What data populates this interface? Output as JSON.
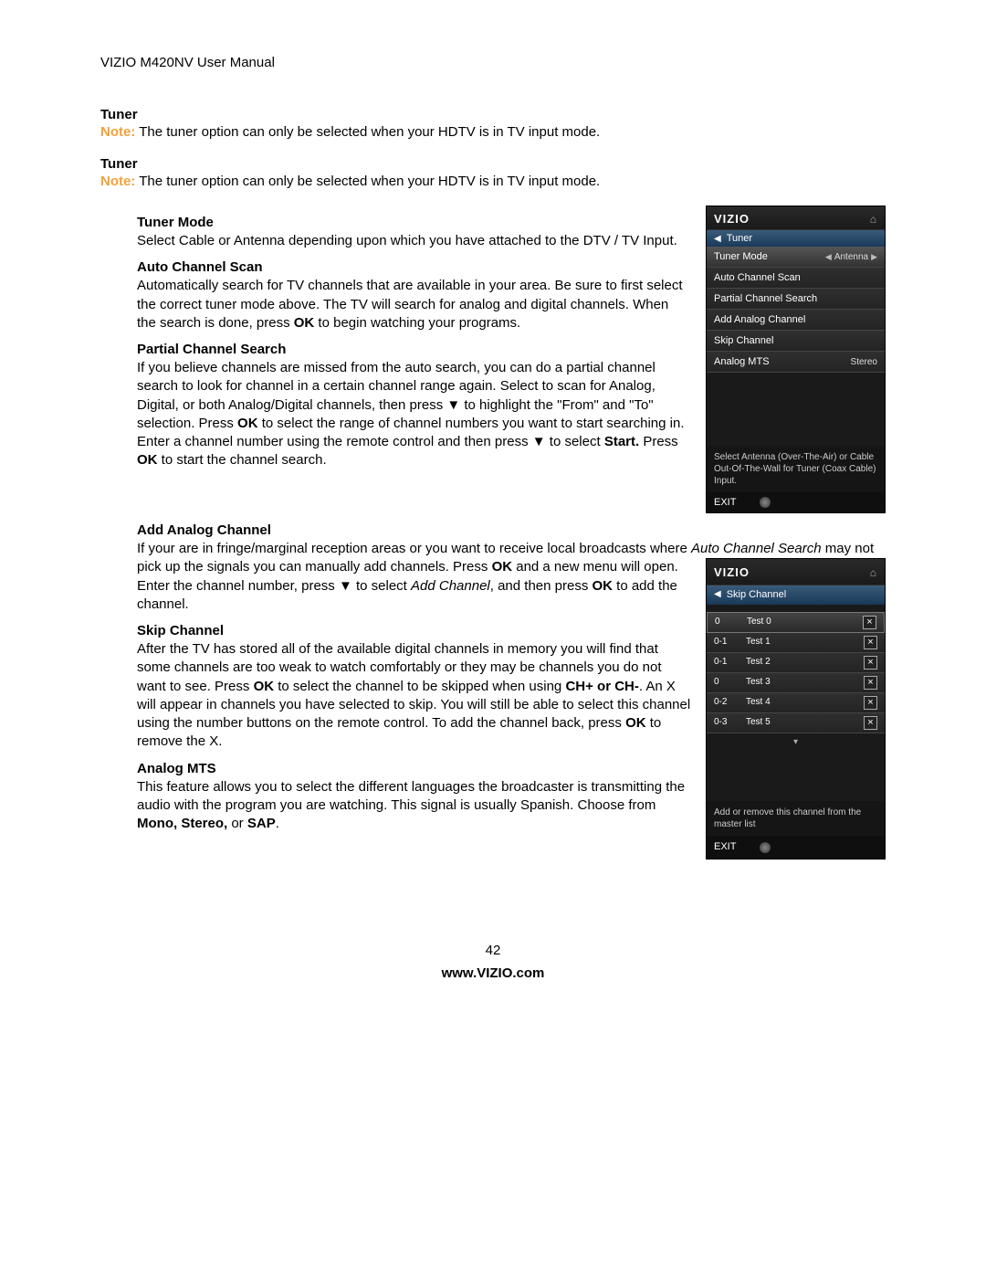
{
  "header": "VIZIO M420NV User Manual",
  "tuner1": {
    "title": "Tuner",
    "note_label": "Note:",
    "note_text": " The tuner option can only be selected when your HDTV is in TV input mode."
  },
  "tuner2": {
    "title": "Tuner",
    "note_label": "Note:",
    "note_text": " The tuner option can only be selected when your HDTV is in TV input mode."
  },
  "sections": {
    "tuner_mode": {
      "title": "Tuner Mode",
      "body": "Select Cable or Antenna depending upon which you have attached to the DTV / TV Input."
    },
    "auto_scan": {
      "title": "Auto Channel Scan",
      "body_a": "Automatically search for TV channels that are available in your area. Be sure to first select the correct tuner mode above. The TV will search for analog and digital channels. When the search is done, press ",
      "ok": "OK",
      "body_b": " to begin watching your programs."
    },
    "partial": {
      "title": "Partial Channel Search",
      "p1": "If you believe channels are missed from the auto search, you can do a partial channel search to look for channel in a certain channel range again. Select to scan for Analog, Digital, or both Analog/Digital channels, then press ▼ to highlight the \"From\" and \"To\" selection. Press ",
      "ok1": "OK",
      "p2": " to select the range of channel numbers you want to start searching in. Enter a channel number using the remote control and then press ▼ to select ",
      "start": "Start.",
      "p3": " Press ",
      "ok2": "OK",
      "p4": " to start the channel search."
    },
    "add_analog": {
      "title": "Add Analog Channel",
      "p1": "If your are in fringe/marginal reception areas or you want to receive local broadcasts where ",
      "italic1": "Auto Channel Search",
      "p2": " may not pick up the signals you can manually add channels. Press ",
      "ok1": "OK",
      "p3": " and a new menu will open. Enter the channel number, press ▼ to select ",
      "italic2": "Add Channel",
      "p4": ", and then press ",
      "ok2": "OK",
      "p5": " to add the channel."
    },
    "skip": {
      "title": "Skip Channel",
      "p1": "After the TV has stored all of the available digital channels in memory you will find that some channels are too weak to watch comfortably or they may be channels you do not want to see. Press ",
      "ok1": "OK",
      "p2": " to select the channel to be skipped when using ",
      "chpm": "CH+ or CH-",
      "p3": ". An X will appear in channels you have selected to skip. You will still be able to select this channel using the number buttons on the remote control. To add the channel back, press ",
      "ok2": "OK",
      "p4": " to remove the X."
    },
    "analog_mts": {
      "title": "Analog MTS",
      "p1": "This feature allows you to select the different languages the broadcaster is transmitting the audio with the program you are watching. This signal is usually Spanish. Choose from ",
      "opts": "Mono, Stereo,",
      "or": " or ",
      "sap": "SAP",
      "dot": "."
    }
  },
  "menu1": {
    "brand": "VIZIO",
    "crumb": "Tuner",
    "items": [
      {
        "label": "Tuner Mode",
        "value": "Antenna",
        "highlight": true,
        "arrows": true
      },
      {
        "label": "Auto Channel Scan",
        "value": ""
      },
      {
        "label": "Partial Channel Search",
        "value": ""
      },
      {
        "label": "Add Analog Channel",
        "value": ""
      },
      {
        "label": "Skip Channel",
        "value": ""
      },
      {
        "label": "Analog MTS",
        "value": "Stereo"
      }
    ],
    "help": "Select Antenna (Over-The-Air) or Cable Out-Of-The-Wall for Tuner (Coax Cable) Input.",
    "exit": "EXIT"
  },
  "menu2": {
    "brand": "VIZIO",
    "crumb": "Skip Channel",
    "rows": [
      {
        "num": "0",
        "name": "Test 0",
        "x": true,
        "highlight": true
      },
      {
        "num": "0-1",
        "name": "Test 1",
        "x": true
      },
      {
        "num": "0-1",
        "name": "Test 2",
        "x": true
      },
      {
        "num": "0",
        "name": "Test 3",
        "x": true
      },
      {
        "num": "0-2",
        "name": "Test 4",
        "x": true
      },
      {
        "num": "0-3",
        "name": "Test 5",
        "x": true
      }
    ],
    "scroll": "▾",
    "help": "Add or remove this channel from the master list",
    "exit": "EXIT"
  },
  "footer": {
    "page": "42",
    "url": "www.VIZIO.com"
  }
}
